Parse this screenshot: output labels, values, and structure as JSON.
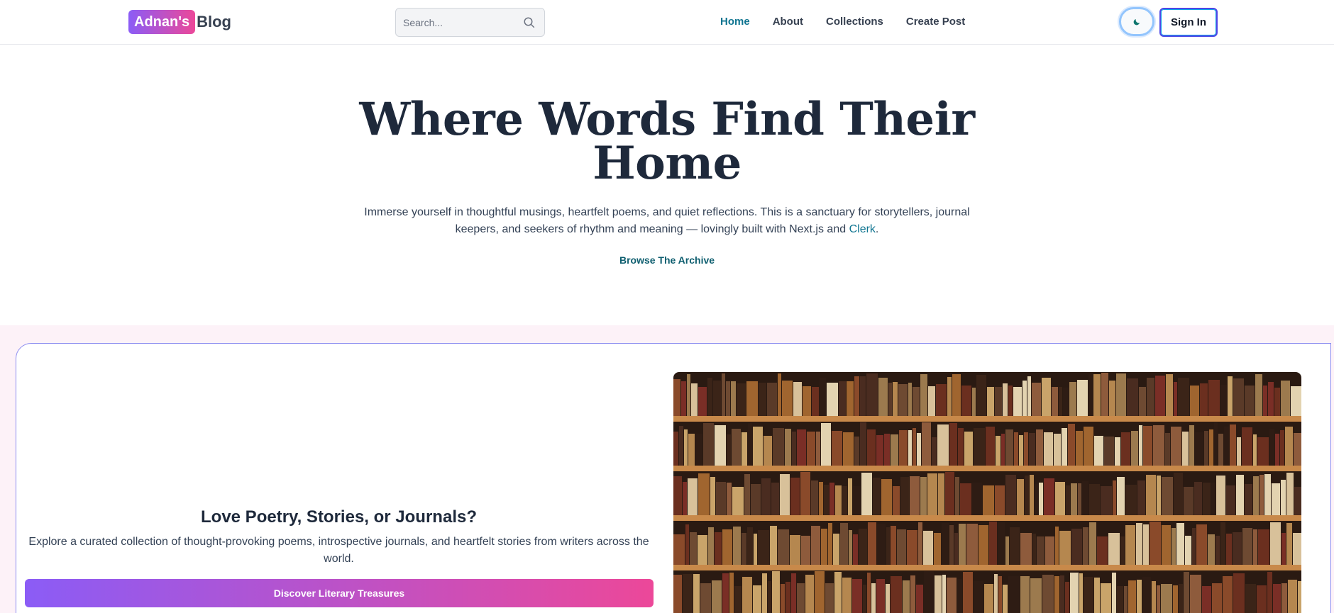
{
  "header": {
    "logo_badge": "Adnan's",
    "logo_text": "Blog",
    "search_placeholder": "Search...",
    "nav": [
      {
        "label": "Home",
        "active": true
      },
      {
        "label": "About",
        "active": false
      },
      {
        "label": "Collections",
        "active": false
      },
      {
        "label": "Create Post",
        "active": false
      }
    ],
    "theme_icon": "moon-icon",
    "signin_label": "Sign In"
  },
  "hero": {
    "title": "Where Words Find Their Home",
    "subtitle_part1": "Immerse yourself in thoughtful musings, heartfelt poems, and quiet reflections. This is a sanctuary for storytellers, journal keepers, and seekers of rhythm and meaning — lovingly built with Next.js and ",
    "subtitle_link": "Clerk",
    "subtitle_end": ".",
    "archive_link": "Browse The Archive"
  },
  "feature": {
    "title": "Love Poetry, Stories, or Journals?",
    "description": "Explore a curated collection of thought-provoking poems, introspective journals, and heartfelt stories from writers across the world.",
    "button_label": "Discover Literary Treasures",
    "image": "bookshelf-photo"
  },
  "colors": {
    "accent": "#0e7490",
    "gradient_start": "#8b5cf6",
    "gradient_end": "#ec4899",
    "section_bg": "#fdf2f8"
  }
}
